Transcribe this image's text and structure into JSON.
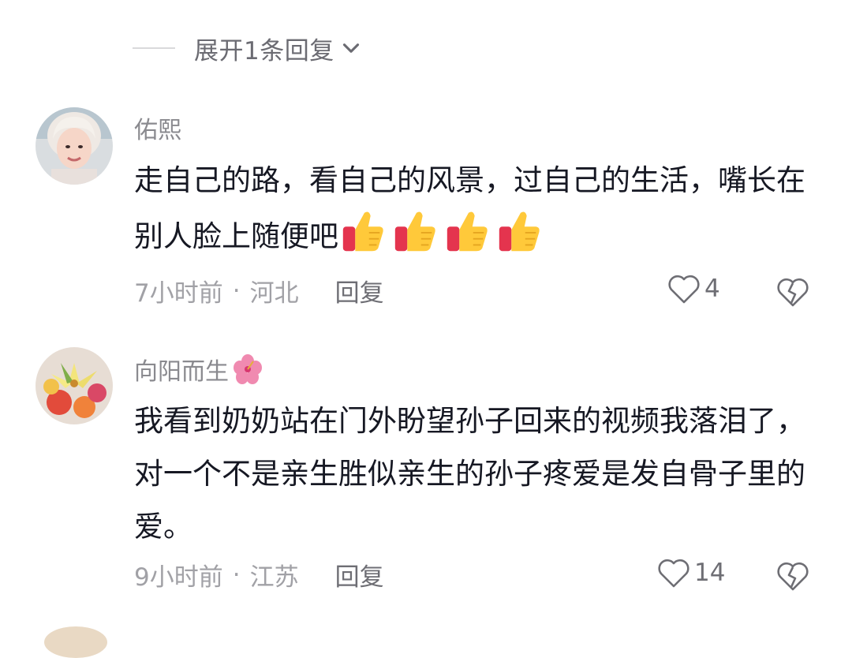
{
  "expand": {
    "label": "展开1条回复"
  },
  "comments": [
    {
      "author": "佑熙",
      "text": "走自己的路，看自己的风景，过自己的生活，嘴长在别人脸上随便吧",
      "emoji_count": 4,
      "emoji_icon": "thumbs-up-emoji",
      "time": "7小时前",
      "separator": "·",
      "location": "河北",
      "reply_label": "回复",
      "likes": "4"
    },
    {
      "author": "向阳而生",
      "author_emoji": "hibiscus-emoji",
      "text": "我看到奶奶站在门外盼望孙子回来的视频我落泪了，对一个不是亲生胜似亲生的孙子疼爱是发自骨子里的爱。",
      "time": "9小时前",
      "separator": "·",
      "location": "江苏",
      "reply_label": "回复",
      "likes": "14"
    }
  ]
}
